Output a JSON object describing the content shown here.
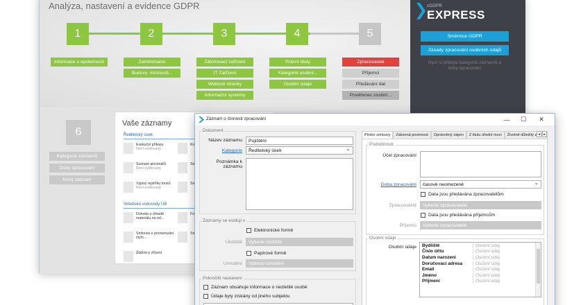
{
  "main": {
    "title": "Analýza, nastavení a evidence GDPR",
    "steps": [
      "1",
      "2",
      "3",
      "4",
      "5"
    ],
    "step6": "6",
    "columns": [
      [
        "Informace o společnosti"
      ],
      [
        "Zaměstnanci",
        "Budovy, místnosti..."
      ],
      [
        "Zálohovací zařízení",
        "IT Zařízení",
        "Webové stránky",
        "Informační systémy"
      ],
      [
        "Právní tituly",
        "Kategorie osobní...",
        "Osobní údaje"
      ],
      [
        "Zpracovatelé",
        "Příjemci",
        "Předávání dat",
        "Pověřenec osobní..."
      ]
    ],
    "side_buttons": [
      "Kategorie záznamů",
      "Doby zpracování",
      "Nový záznam"
    ]
  },
  "records": {
    "title": "Vaše záznamy",
    "section1": "Ředitelský úsek",
    "section2": "Středisko vodovody UB",
    "status": "Není evidovaný",
    "cards_left": [
      "Exekuční příkazy",
      "Seznam akcionářů",
      "Výpisy rejstříku trestů"
    ],
    "cards_right": [
      "Ko...",
      "Sm...",
      "Sm..."
    ],
    "cards2_left": [
      "Dohoda o úhradě materiálu na od...",
      "Smlouva o provozování čtyřc...",
      "Žádost o zřízení"
    ],
    "cards2_right": [
      "Fo...",
      "Sm...",
      ""
    ]
  },
  "brand": {
    "small": "zGDPR",
    "big": "EXPRESS",
    "btn1": "Směrnice GDPR",
    "btn2": "Zásady zpracování osobních údajů",
    "hint": "Nyní si přidejte kategorie záznamů a doby zpracování"
  },
  "dialog": {
    "title": "Záznam o činnosti zpracování",
    "ctl_min": "—",
    "ctl_max": "☐",
    "ctl_close": "✕",
    "doc_group": "Dokument",
    "name_label": "Název záznamu",
    "name_value": "Pojištění",
    "category_label": "Kategorie",
    "category_value": "Ředitelský úsek",
    "note_label": "Poznámka k záznamu",
    "evidence_group": "Záznamy se evidují v",
    "electronic": "Elektronické formě",
    "storage_label": "Úložiště",
    "storage_value": "Vyberte úložiště",
    "paper": "Papírové formě",
    "location_label": "Umístění",
    "location_value": "Vyberte umístění",
    "advanced_group": "Pokročilé nastavení",
    "adv1": "Záznam obsahuje informace o nezletilé osobě",
    "adv2": "Údaje byly získány od jiného subjektu",
    "tabs": [
      "Plnění smlouvy",
      "Zákonná povinnost",
      "Oprávněný zájem",
      "Z titulu úřední moci",
      "Životně důležitý zájem"
    ],
    "tab_prev": "◂",
    "tab_next": "▸",
    "details_group": "Podrobnosti",
    "purpose_label": "Účel zpracování",
    "duration_label": "Doba zpracování",
    "duration_value": "časově neomezeně",
    "to_processors": "Data jsou předávána zpracovatelům",
    "processor_label": "Zpracovatelé",
    "processor_value": "Vyberte zpracovatele",
    "to_recipients": "Data jsou předávána příjemcům",
    "recipient_label": "Příjemci",
    "recipient_value": "Vyberte zpracovatele",
    "personal_group": "Osobní údaje",
    "personal_label": "Osobní údaje",
    "personal_rows": [
      "Bydliště",
      "Číslo účtu",
      "Datum narození",
      "Doručovací adresa",
      "Email",
      "Jméno",
      "Příjmení"
    ],
    "personal_placeholder": "Osobní údaj",
    "dd_arrow": "▾"
  }
}
